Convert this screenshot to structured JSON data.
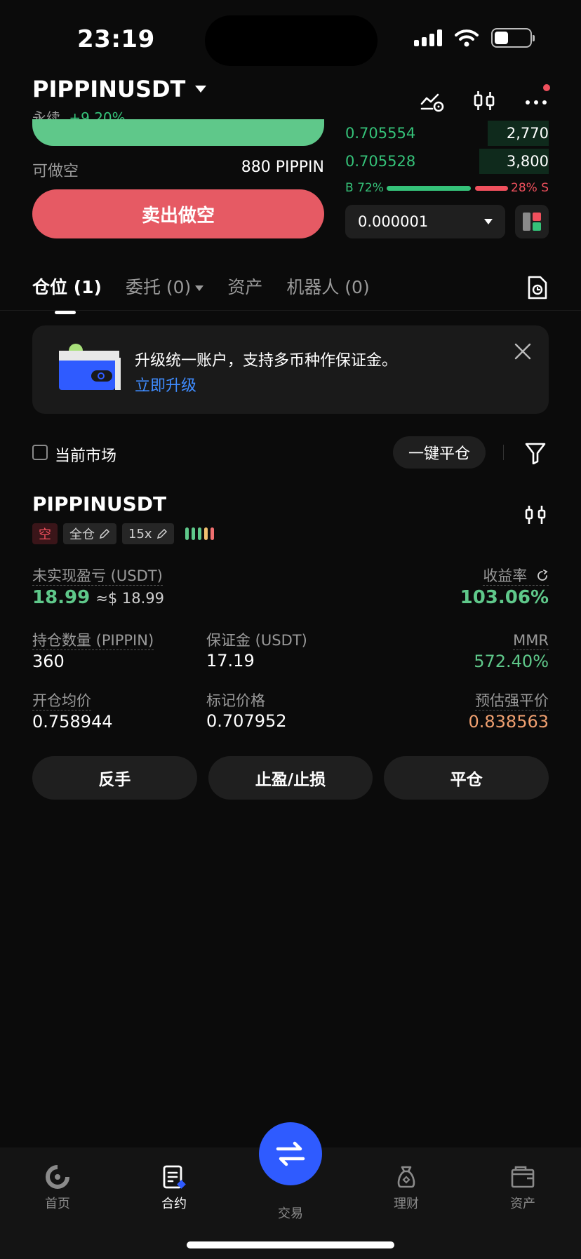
{
  "status": {
    "time": "23:19"
  },
  "header": {
    "symbol": "PIPPINUSDT",
    "contract_type": "永续",
    "change": "+9.20%"
  },
  "trade_panel": {
    "avail_label": "可做空",
    "avail_value": "880 PIPPIN",
    "sell_button": "卖出做空"
  },
  "orderbook": {
    "rows": [
      {
        "price": "0.705554",
        "qty": "2,770",
        "depth": 0.3
      },
      {
        "price": "0.705528",
        "qty": "3,800",
        "depth": 0.34
      }
    ],
    "buy_ratio": "B 72%",
    "sell_ratio": "28% S",
    "buy_fraction": 0.72,
    "precision": "0.000001"
  },
  "tabs": [
    {
      "label": "仓位 (1)"
    },
    {
      "label": "委托 (0)"
    },
    {
      "label": "资产"
    },
    {
      "label": "机器人 (0)"
    }
  ],
  "banner": {
    "text": "升级统一账户，支持多币种作保证金。",
    "link": "立即升级"
  },
  "filters": {
    "current_market": "当前市场",
    "close_all": "一键平仓"
  },
  "position": {
    "symbol": "PIPPINUSDT",
    "side_tag": "空",
    "margin_mode": "全仓",
    "leverage": "15x",
    "upnl_label": "未实现盈亏 (USDT)",
    "upnl_value": "18.99",
    "upnl_approx": "≈$ 18.99",
    "roe_label": "收益率",
    "roe_value": "103.06%",
    "qty_label": "持仓数量 (PIPPIN)",
    "qty_value": "360",
    "margin_label": "保证金 (USDT)",
    "margin_value": "17.19",
    "mmr_label": "MMR",
    "mmr_value": "572.40%",
    "entry_label": "开仓均价",
    "entry_value": "0.758944",
    "mark_label": "标记价格",
    "mark_value": "0.707952",
    "liq_label": "预估强平价",
    "liq_value": "0.838563"
  },
  "actions": {
    "reverse": "反手",
    "tpsl": "止盈/止损",
    "close": "平仓"
  },
  "nav": {
    "home": "首页",
    "futures": "合约",
    "trade": "交易",
    "earn": "理财",
    "assets": "资产"
  },
  "colors": {
    "green": "#35c279",
    "red": "#f0505d",
    "accent_blue": "#2f5bff",
    "orange": "#f0a070"
  }
}
